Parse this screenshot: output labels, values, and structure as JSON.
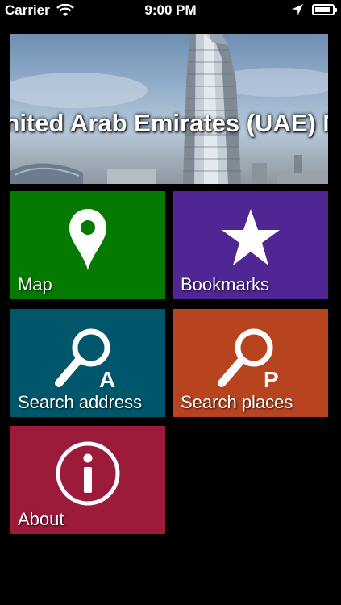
{
  "status_bar": {
    "carrier": "Carrier",
    "time": "9:00 PM",
    "battery_level": 0.9
  },
  "banner": {
    "title": "United Arab Emirates (UAE) Map"
  },
  "tiles": [
    {
      "label": "Map",
      "icon": "map-pin-icon",
      "color": "#047a00"
    },
    {
      "label": "Bookmarks",
      "icon": "star-icon",
      "color": "#4f2693"
    },
    {
      "label": "Search address",
      "icon": "search-address-icon",
      "icon_letter": "A",
      "color": "#00566b"
    },
    {
      "label": "Search places",
      "icon": "search-places-icon",
      "icon_letter": "P",
      "color": "#b8431f"
    },
    {
      "label": "About",
      "icon": "info-icon",
      "color": "#9c1b3a"
    }
  ]
}
